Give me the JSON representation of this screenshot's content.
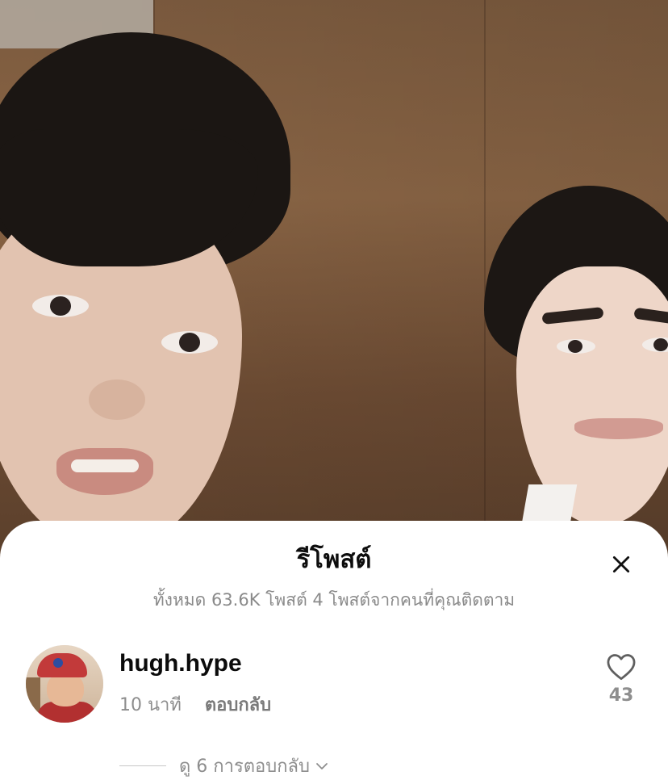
{
  "sheet": {
    "title": "รีโพสต์",
    "subtitle": "ทั้งหมด 63.6K โพสต์ 4 โพสต์จากคนที่คุณติดตาม",
    "close_icon": "close-icon"
  },
  "comment": {
    "username": "hugh.hype",
    "time": "10 นาที",
    "reply_label": "ตอบกลับ",
    "like_count": "43",
    "like_icon": "heart-outline-icon",
    "view_replies_label": "ดู 6 การตอบกลับ",
    "view_replies_icon": "chevron-down-icon"
  },
  "colors": {
    "sheet_bg": "#ffffff",
    "text_primary": "#0b0b0b",
    "text_secondary": "#8e8e8e"
  }
}
